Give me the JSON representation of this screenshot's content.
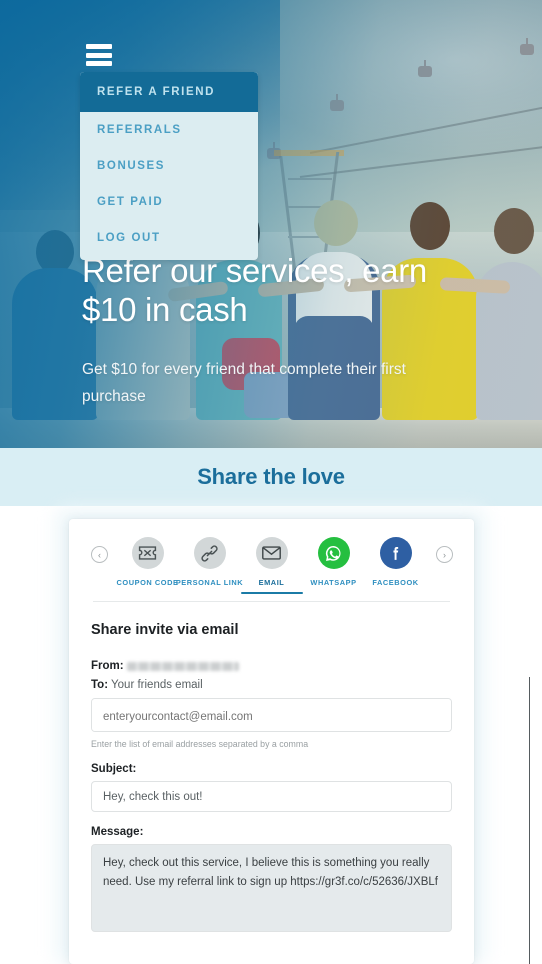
{
  "nav": {
    "menu_icon": "hamburger-icon",
    "items": [
      {
        "label": "REFER A FRIEND",
        "active": true
      },
      {
        "label": "REFERRALS",
        "active": false
      },
      {
        "label": "BONUSES",
        "active": false
      },
      {
        "label": "GET PAID",
        "active": false
      },
      {
        "label": "LOG OUT",
        "active": false
      }
    ]
  },
  "hero": {
    "title": "Refer our services, earn $10 in cash",
    "subtitle": "Get $10 for every friend that complete their first purchase"
  },
  "share_banner": {
    "title": "Share the love"
  },
  "share_tabs": {
    "prev_arrow": "‹",
    "next_arrow": "›",
    "items": [
      {
        "label": "COUPON CODE",
        "icon": "coupon-ticket-icon",
        "active": false,
        "color": "#d2d7d8"
      },
      {
        "label": "PERSONAL LINK",
        "icon": "chain-link-icon",
        "active": false,
        "color": "#d2d7d8"
      },
      {
        "label": "EMAIL",
        "icon": "envelope-icon",
        "active": true,
        "color": "#d2d7d8"
      },
      {
        "label": "WHATSAPP",
        "icon": "whatsapp-icon",
        "active": false,
        "color": "#25bf40"
      },
      {
        "label": "FACEBOOK",
        "icon": "facebook-icon",
        "active": false,
        "color": "#2e5fa3"
      }
    ]
  },
  "form": {
    "heading": "Share invite via email",
    "from_label": "From:",
    "from_value": "",
    "to_label": "To:",
    "to_value": "Your friends email",
    "to_placeholder": "enteryourcontact@email.com",
    "to_hint": "Enter the list of email addresses separated by a comma",
    "subject_label": "Subject:",
    "subject_value": "Hey, check this out!",
    "message_label": "Message:",
    "message_value": "Hey, check out this service, I believe this is something you really need. Use my referral link to sign up https://gr3f.co/c/52636/JXBLf"
  },
  "colors": {
    "brand_blue": "#1b6e9b",
    "menu_active_bg": "#136b97",
    "menu_bg": "#dcedf1",
    "menu_text": "#4b9fc4",
    "banner_bg": "#d9eef4",
    "tab_active": "#1b7ba6",
    "whatsapp_green": "#25bf40",
    "facebook_blue": "#2e5fa3"
  }
}
